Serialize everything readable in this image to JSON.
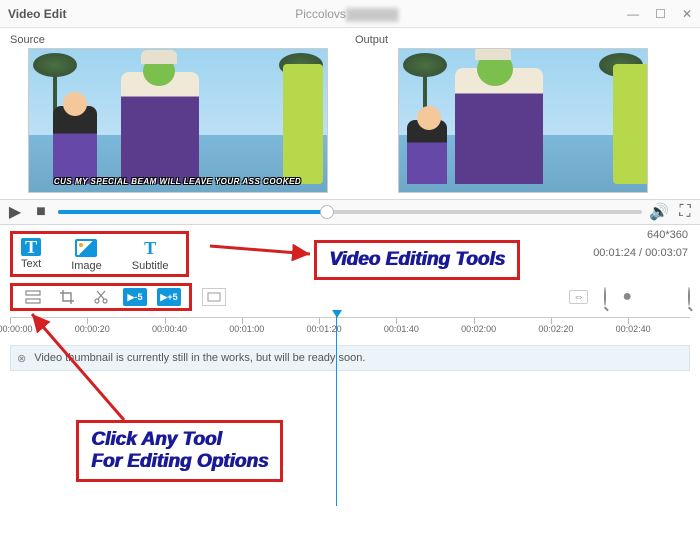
{
  "window": {
    "title": "Video Edit",
    "filename": "Piccolovs",
    "minimize": "—",
    "maximize": "☐",
    "close": "✕"
  },
  "previews": {
    "source_label": "Source",
    "output_label": "Output",
    "subtitle_text": "CUS MY SPECIAL BEAM WILL LEAVE YOUR ASS COOKED"
  },
  "player": {
    "play_icon": "▶",
    "stop_icon": "■",
    "volume_icon": "🔊",
    "fullscreen_icon": "⛶",
    "progress_pct": 46
  },
  "tools": {
    "text": "Text",
    "image": "Image",
    "subtitle": "Subtitle"
  },
  "meta": {
    "resolution": "640*360",
    "time": "00:01:24 / 00:03:07"
  },
  "edit_buttons": {
    "seek_back": "▶-5",
    "seek_fwd": "▶+5"
  },
  "zoom": {
    "link_icon": "⇔",
    "out_icon": "−",
    "slider_icon": "●",
    "in_icon": "+"
  },
  "ruler_ticks": [
    "00:00:00",
    "00:00:20",
    "00:00:40",
    "00:01:00",
    "00:01:20",
    "00:01:40",
    "00:02:00",
    "00:02:20",
    "00:02:40"
  ],
  "ruler_playhead_pct": 48,
  "thumb": {
    "close": "⊗",
    "msg": "Video thumbnail is currently still in the works, but will be ready soon."
  },
  "callouts": {
    "vet": "Video Editing Tools",
    "cat_l1": "Click Any Tool",
    "cat_l2": "For Editing Options"
  }
}
